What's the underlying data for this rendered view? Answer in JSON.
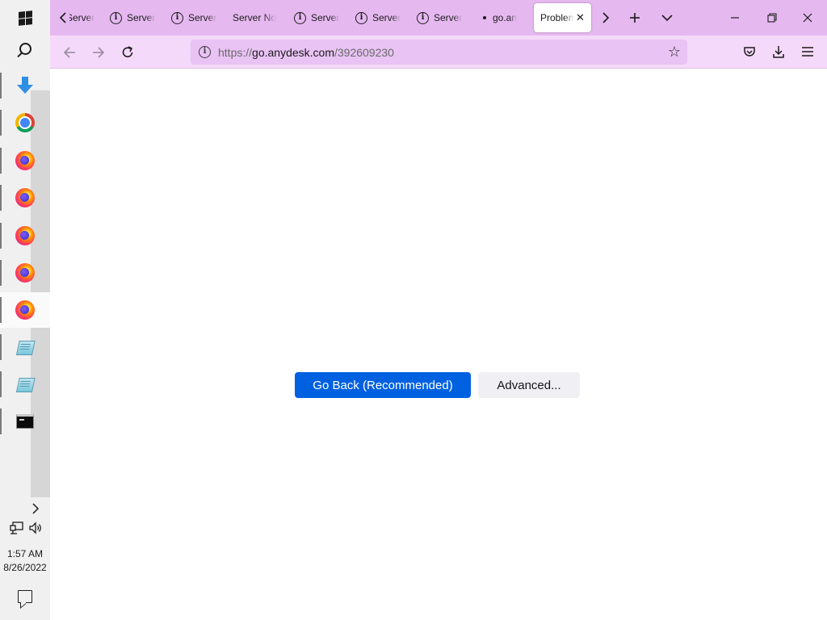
{
  "taskbar": {
    "apps": [
      {
        "name": "downloads"
      },
      {
        "name": "chrome"
      },
      {
        "name": "firefox-1"
      },
      {
        "name": "firefox-2"
      },
      {
        "name": "firefox-3"
      },
      {
        "name": "firefox-4"
      },
      {
        "name": "firefox-5"
      },
      {
        "name": "notepad-1"
      },
      {
        "name": "notepad-2"
      },
      {
        "name": "command-prompt"
      }
    ],
    "clock": {
      "time": "1:57 AM",
      "date": "8/26/2022"
    }
  },
  "browser": {
    "tabs": [
      {
        "label": "Server",
        "icon": "info-icon"
      },
      {
        "label": "Server",
        "icon": "info-icon"
      },
      {
        "label": "Server",
        "icon": "info-icon"
      },
      {
        "label": "Server No",
        "icon": "none"
      },
      {
        "label": "Server",
        "icon": "info-icon"
      },
      {
        "label": "Server",
        "icon": "info-icon"
      },
      {
        "label": "Server",
        "icon": "info-icon"
      },
      {
        "label": "go.an",
        "icon": "dot"
      },
      {
        "label": "Problem",
        "icon": "none",
        "selected": true
      }
    ],
    "url": {
      "prefix": "https://",
      "host": "go.anydesk.com",
      "path": "/392609230"
    },
    "accent": "#e6b8f0"
  },
  "page": {
    "go_back_label": "Go Back (Recommended)",
    "advanced_label": "Advanced..."
  }
}
